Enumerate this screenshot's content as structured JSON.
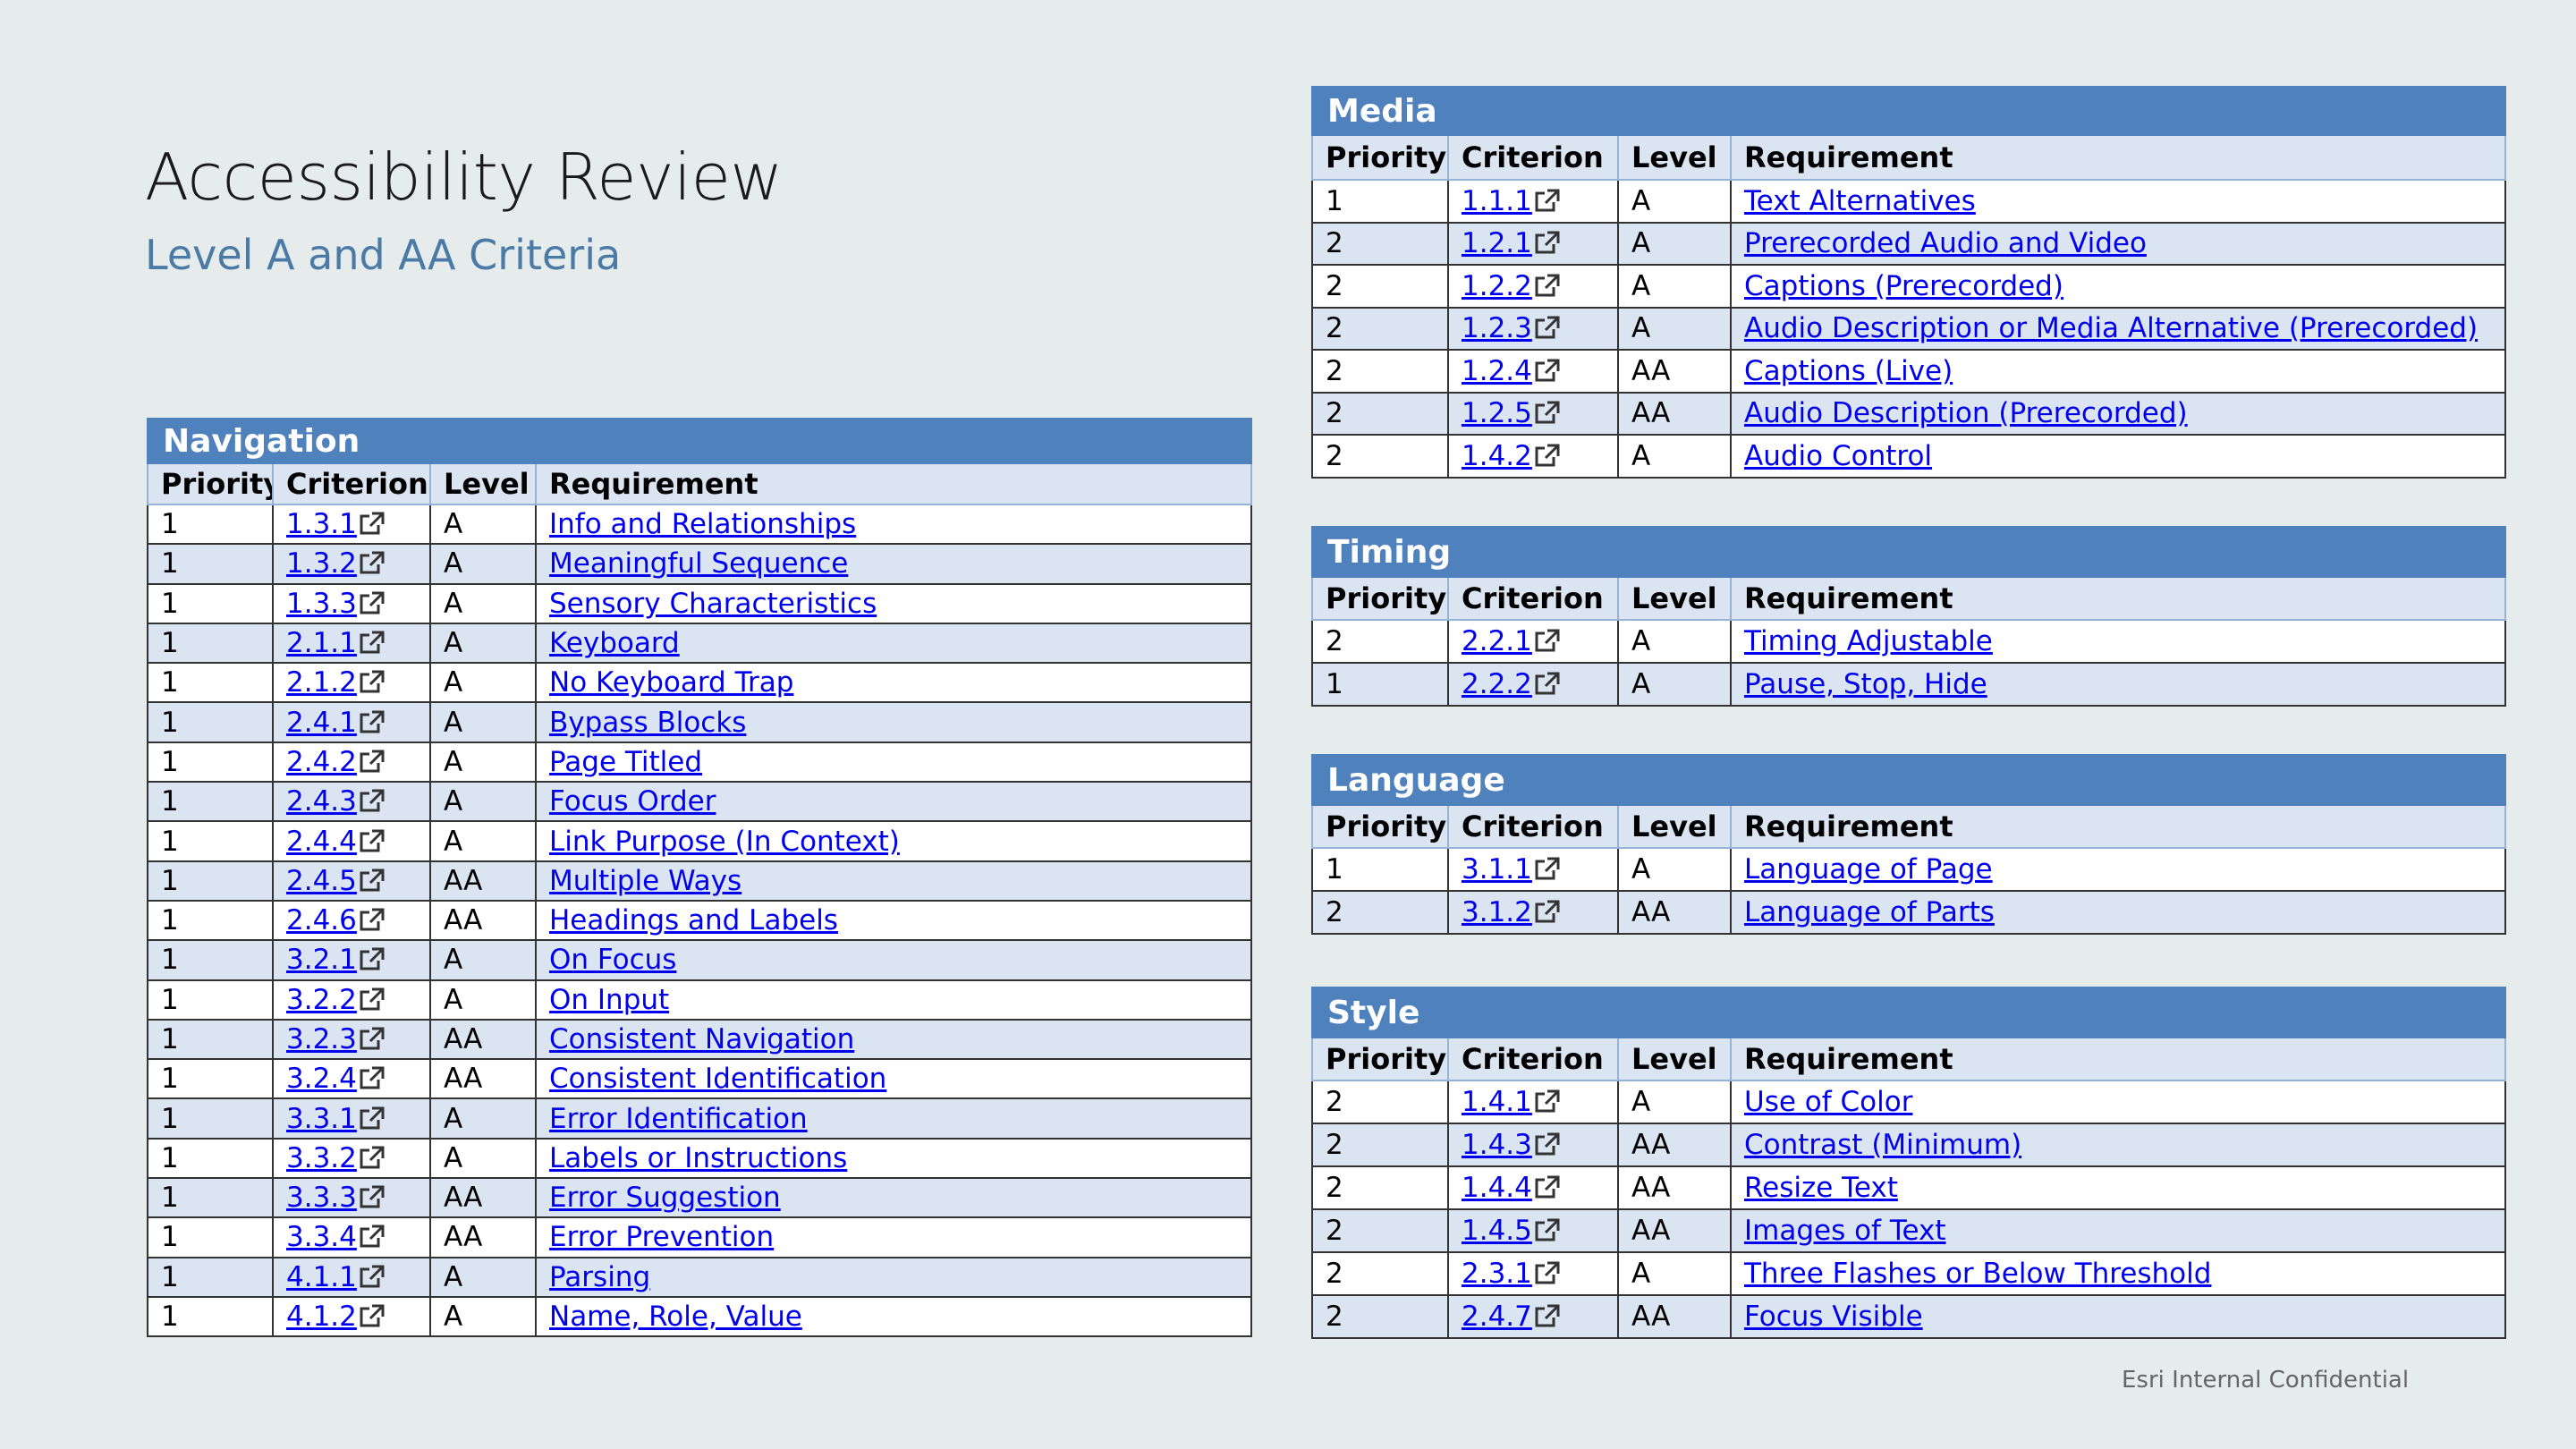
{
  "slide": {
    "title": "Accessibility Review",
    "subtitle": "Level A and AA Criteria",
    "footer": "Esri Internal Confidential"
  },
  "colors": {
    "section_header": "#4f81bd",
    "row_alt": "#dbe5f1",
    "link": "#0000ee",
    "subtitle": "#4a7aa6"
  },
  "columns": {
    "priority": "Priority",
    "criterion": "Criterion",
    "level": "Level",
    "requirement": "Requirement"
  },
  "link_icon": "external-link-icon",
  "sections": {
    "navigation": {
      "title": "Navigation",
      "rows": [
        {
          "priority": "1",
          "criterion": "1.3.1",
          "level": "A",
          "requirement": "Info and Relationships"
        },
        {
          "priority": "1",
          "criterion": "1.3.2",
          "level": "A",
          "requirement": "Meaningful Sequence"
        },
        {
          "priority": "1",
          "criterion": "1.3.3",
          "level": "A",
          "requirement": "Sensory Characteristics"
        },
        {
          "priority": "1",
          "criterion": "2.1.1",
          "level": "A",
          "requirement": "Keyboard"
        },
        {
          "priority": "1",
          "criterion": "2.1.2",
          "level": "A",
          "requirement": "No Keyboard Trap"
        },
        {
          "priority": "1",
          "criterion": "2.4.1",
          "level": "A",
          "requirement": "Bypass Blocks"
        },
        {
          "priority": "1",
          "criterion": "2.4.2",
          "level": "A",
          "requirement": "Page Titled"
        },
        {
          "priority": "1",
          "criterion": "2.4.3",
          "level": "A",
          "requirement": "Focus Order"
        },
        {
          "priority": "1",
          "criterion": "2.4.4",
          "level": "A",
          "requirement": "Link Purpose (In Context)"
        },
        {
          "priority": "1",
          "criterion": "2.4.5",
          "level": "AA",
          "requirement": "Multiple Ways"
        },
        {
          "priority": "1",
          "criterion": "2.4.6",
          "level": "AA",
          "requirement": "Headings and Labels"
        },
        {
          "priority": "1",
          "criterion": "3.2.1",
          "level": "A",
          "requirement": "On Focus"
        },
        {
          "priority": "1",
          "criterion": "3.2.2",
          "level": "A",
          "requirement": "On Input"
        },
        {
          "priority": "1",
          "criterion": "3.2.3",
          "level": "AA",
          "requirement": "Consistent Navigation"
        },
        {
          "priority": "1",
          "criterion": "3.2.4",
          "level": "AA",
          "requirement": "Consistent Identification"
        },
        {
          "priority": "1",
          "criterion": "3.3.1",
          "level": "A",
          "requirement": "Error Identification"
        },
        {
          "priority": "1",
          "criterion": "3.3.2",
          "level": "A",
          "requirement": "Labels or Instructions"
        },
        {
          "priority": "1",
          "criterion": "3.3.3",
          "level": "AA",
          "requirement": "Error Suggestion"
        },
        {
          "priority": "1",
          "criterion": "3.3.4",
          "level": "AA",
          "requirement": "Error Prevention"
        },
        {
          "priority": "1",
          "criterion": "4.1.1",
          "level": "A",
          "requirement": "Parsing"
        },
        {
          "priority": "1",
          "criterion": "4.1.2",
          "level": "A",
          "requirement": "Name, Role, Value"
        }
      ]
    },
    "media": {
      "title": "Media",
      "rows": [
        {
          "priority": "1",
          "criterion": "1.1.1",
          "level": "A",
          "requirement": "Text Alternatives"
        },
        {
          "priority": "2",
          "criterion": "1.2.1",
          "level": "A",
          "requirement": "Prerecorded Audio and Video"
        },
        {
          "priority": "2",
          "criterion": "1.2.2",
          "level": "A",
          "requirement": "Captions (Prerecorded)"
        },
        {
          "priority": "2",
          "criterion": "1.2.3",
          "level": "A",
          "requirement": "Audio Description or Media Alternative (Prerecorded)"
        },
        {
          "priority": "2",
          "criterion": "1.2.4",
          "level": "AA",
          "requirement": "Captions (Live)"
        },
        {
          "priority": "2",
          "criterion": "1.2.5",
          "level": "AA",
          "requirement": "Audio Description (Prerecorded)"
        },
        {
          "priority": "2",
          "criterion": "1.4.2",
          "level": "A",
          "requirement": "Audio Control"
        }
      ]
    },
    "timing": {
      "title": "Timing",
      "rows": [
        {
          "priority": "2",
          "criterion": "2.2.1",
          "level": "A",
          "requirement": "Timing Adjustable"
        },
        {
          "priority": "1",
          "criterion": "2.2.2",
          "level": "A",
          "requirement": "Pause, Stop, Hide"
        }
      ]
    },
    "language": {
      "title": "Language",
      "rows": [
        {
          "priority": "1",
          "criterion": "3.1.1",
          "level": "A",
          "requirement": "Language of Page"
        },
        {
          "priority": "2",
          "criterion": "3.1.2",
          "level": "AA",
          "requirement": "Language of Parts"
        }
      ]
    },
    "style": {
      "title": "Style",
      "rows": [
        {
          "priority": "2",
          "criterion": "1.4.1",
          "level": "A",
          "requirement": "Use of Color"
        },
        {
          "priority": "2",
          "criterion": "1.4.3",
          "level": "AA",
          "requirement": "Contrast (Minimum)"
        },
        {
          "priority": "2",
          "criterion": "1.4.4",
          "level": "AA",
          "requirement": "Resize Text"
        },
        {
          "priority": "2",
          "criterion": "1.4.5",
          "level": "AA",
          "requirement": "Images of Text"
        },
        {
          "priority": "2",
          "criterion": "2.3.1",
          "level": "A",
          "requirement": "Three Flashes or Below Threshold"
        },
        {
          "priority": "2",
          "criterion": "2.4.7",
          "level": "AA",
          "requirement": "Focus Visible"
        }
      ]
    }
  }
}
